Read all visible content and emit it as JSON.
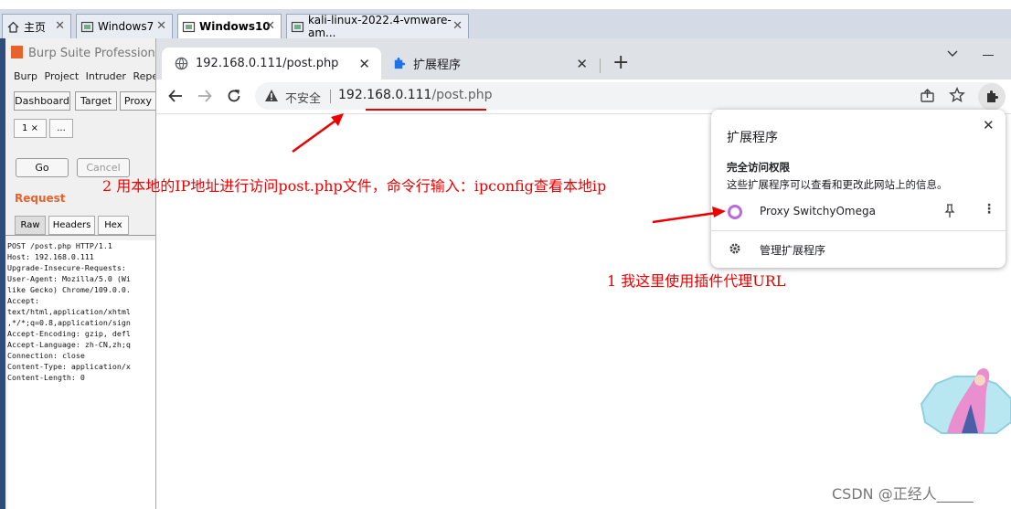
{
  "vmware": {
    "tabs": [
      {
        "label": "主页"
      },
      {
        "label": "Windows7"
      },
      {
        "label": "Windows10"
      },
      {
        "label": "kali-linux-2022.4-vmware-am..."
      }
    ]
  },
  "burp": {
    "title": "Burp Suite Professional",
    "menu": "Burp Project Intruder Repeat",
    "tabs": [
      "Dashboard",
      "Target",
      "Proxy"
    ],
    "subtabs": [
      "1 ×",
      "..."
    ],
    "go_label": "Go",
    "cancel_label": "Cancel",
    "request_label": "Request",
    "view_tabs": [
      "Raw",
      "Headers",
      "Hex"
    ],
    "request_lines": [
      "POST /post.php HTTP/1.1",
      "Host: 192.168.0.111",
      "Upgrade-Insecure-Requests:",
      "User-Agent: Mozilla/5.0 (Wi",
      "like Gecko) Chrome/109.0.0.",
      "Accept:",
      "text/html,application/xhtml",
      ",*/*;q=0.8,application/sign",
      "Accept-Encoding: gzip, defl",
      "Accept-Language: zh-CN,zh;q",
      "Connection: close",
      "Content-Type: application/x",
      "Content-Length: 0"
    ]
  },
  "chrome": {
    "tabs": [
      {
        "label": "192.168.0.111/post.php"
      },
      {
        "label": "扩展程序"
      }
    ],
    "new_tab": "+",
    "security_label": "不安全",
    "url_host": "192.168.0.111",
    "url_path": "/post.php",
    "popup": {
      "title": "扩展程序",
      "section_title": "完全访问权限",
      "section_desc": "这些扩展程序可以查看和更改此网站上的信息。",
      "extension_name": "Proxy SwitchyOmega",
      "manage_label": "管理扩展程序"
    }
  },
  "annotations": {
    "note2": "2 用本地的IP地址进行访问post.php文件，命令行输入：ipconfig查看本地ip",
    "note1": "1 我这里使用插件代理URL"
  },
  "watermark": "CSDN @正经人_____",
  "colors": {
    "annotation": "#e00000",
    "burp_accent": "#e8632b",
    "extension_ring": "#b86bd6"
  }
}
